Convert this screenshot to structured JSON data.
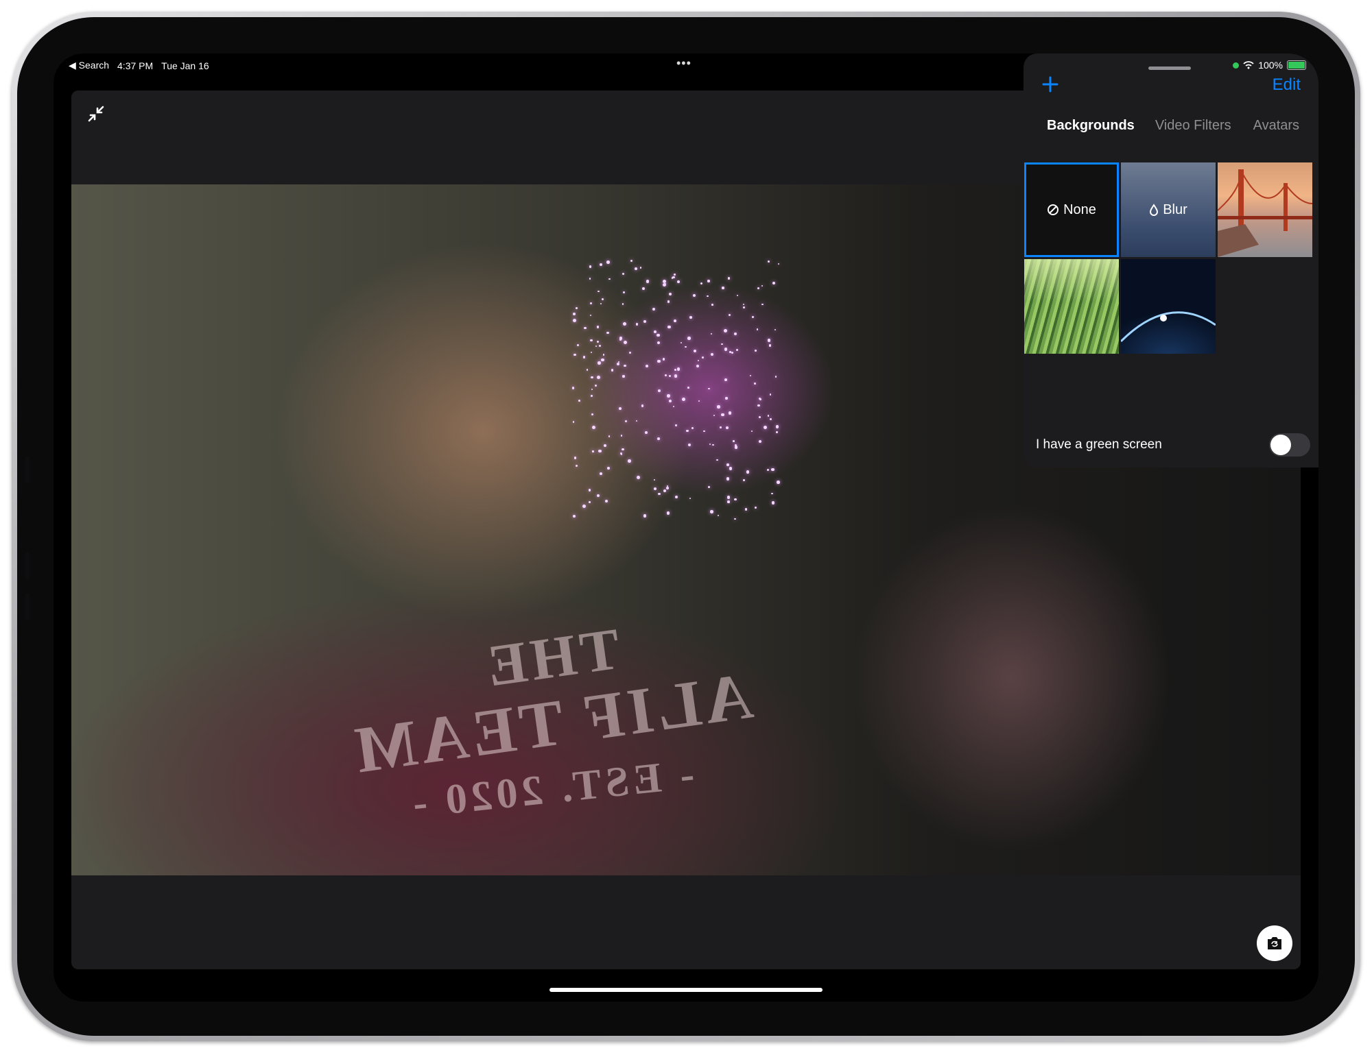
{
  "status_bar": {
    "back_label": "◀ Search",
    "time": "4:37 PM",
    "date": "Tue Jan 16",
    "more_dots": "•••",
    "battery": "100%"
  },
  "video": {
    "shirt_line1": "THE",
    "shirt_line2": "ALIF TEAM",
    "shirt_line3": "- EST. 2020 -"
  },
  "panel": {
    "edit_label": "Edit",
    "tabs": [
      "Backgrounds",
      "Video Filters",
      "Avatars"
    ],
    "active_tab": "Backgrounds",
    "backgrounds": [
      {
        "label": "None",
        "icon": "prohibited-icon",
        "selected": true
      },
      {
        "label": "Blur",
        "icon": "drop-icon",
        "selected": false
      },
      {
        "label": "",
        "icon": "golden-gate-image",
        "selected": false
      },
      {
        "label": "",
        "icon": "grass-image",
        "selected": false
      },
      {
        "label": "",
        "icon": "earth-image",
        "selected": false
      }
    ],
    "green_screen_label": "I have a green screen",
    "green_screen_on": false
  },
  "colors": {
    "accent": "#0a84ff",
    "panel_bg": "#1c1c1e",
    "battery_green": "#34c759"
  }
}
